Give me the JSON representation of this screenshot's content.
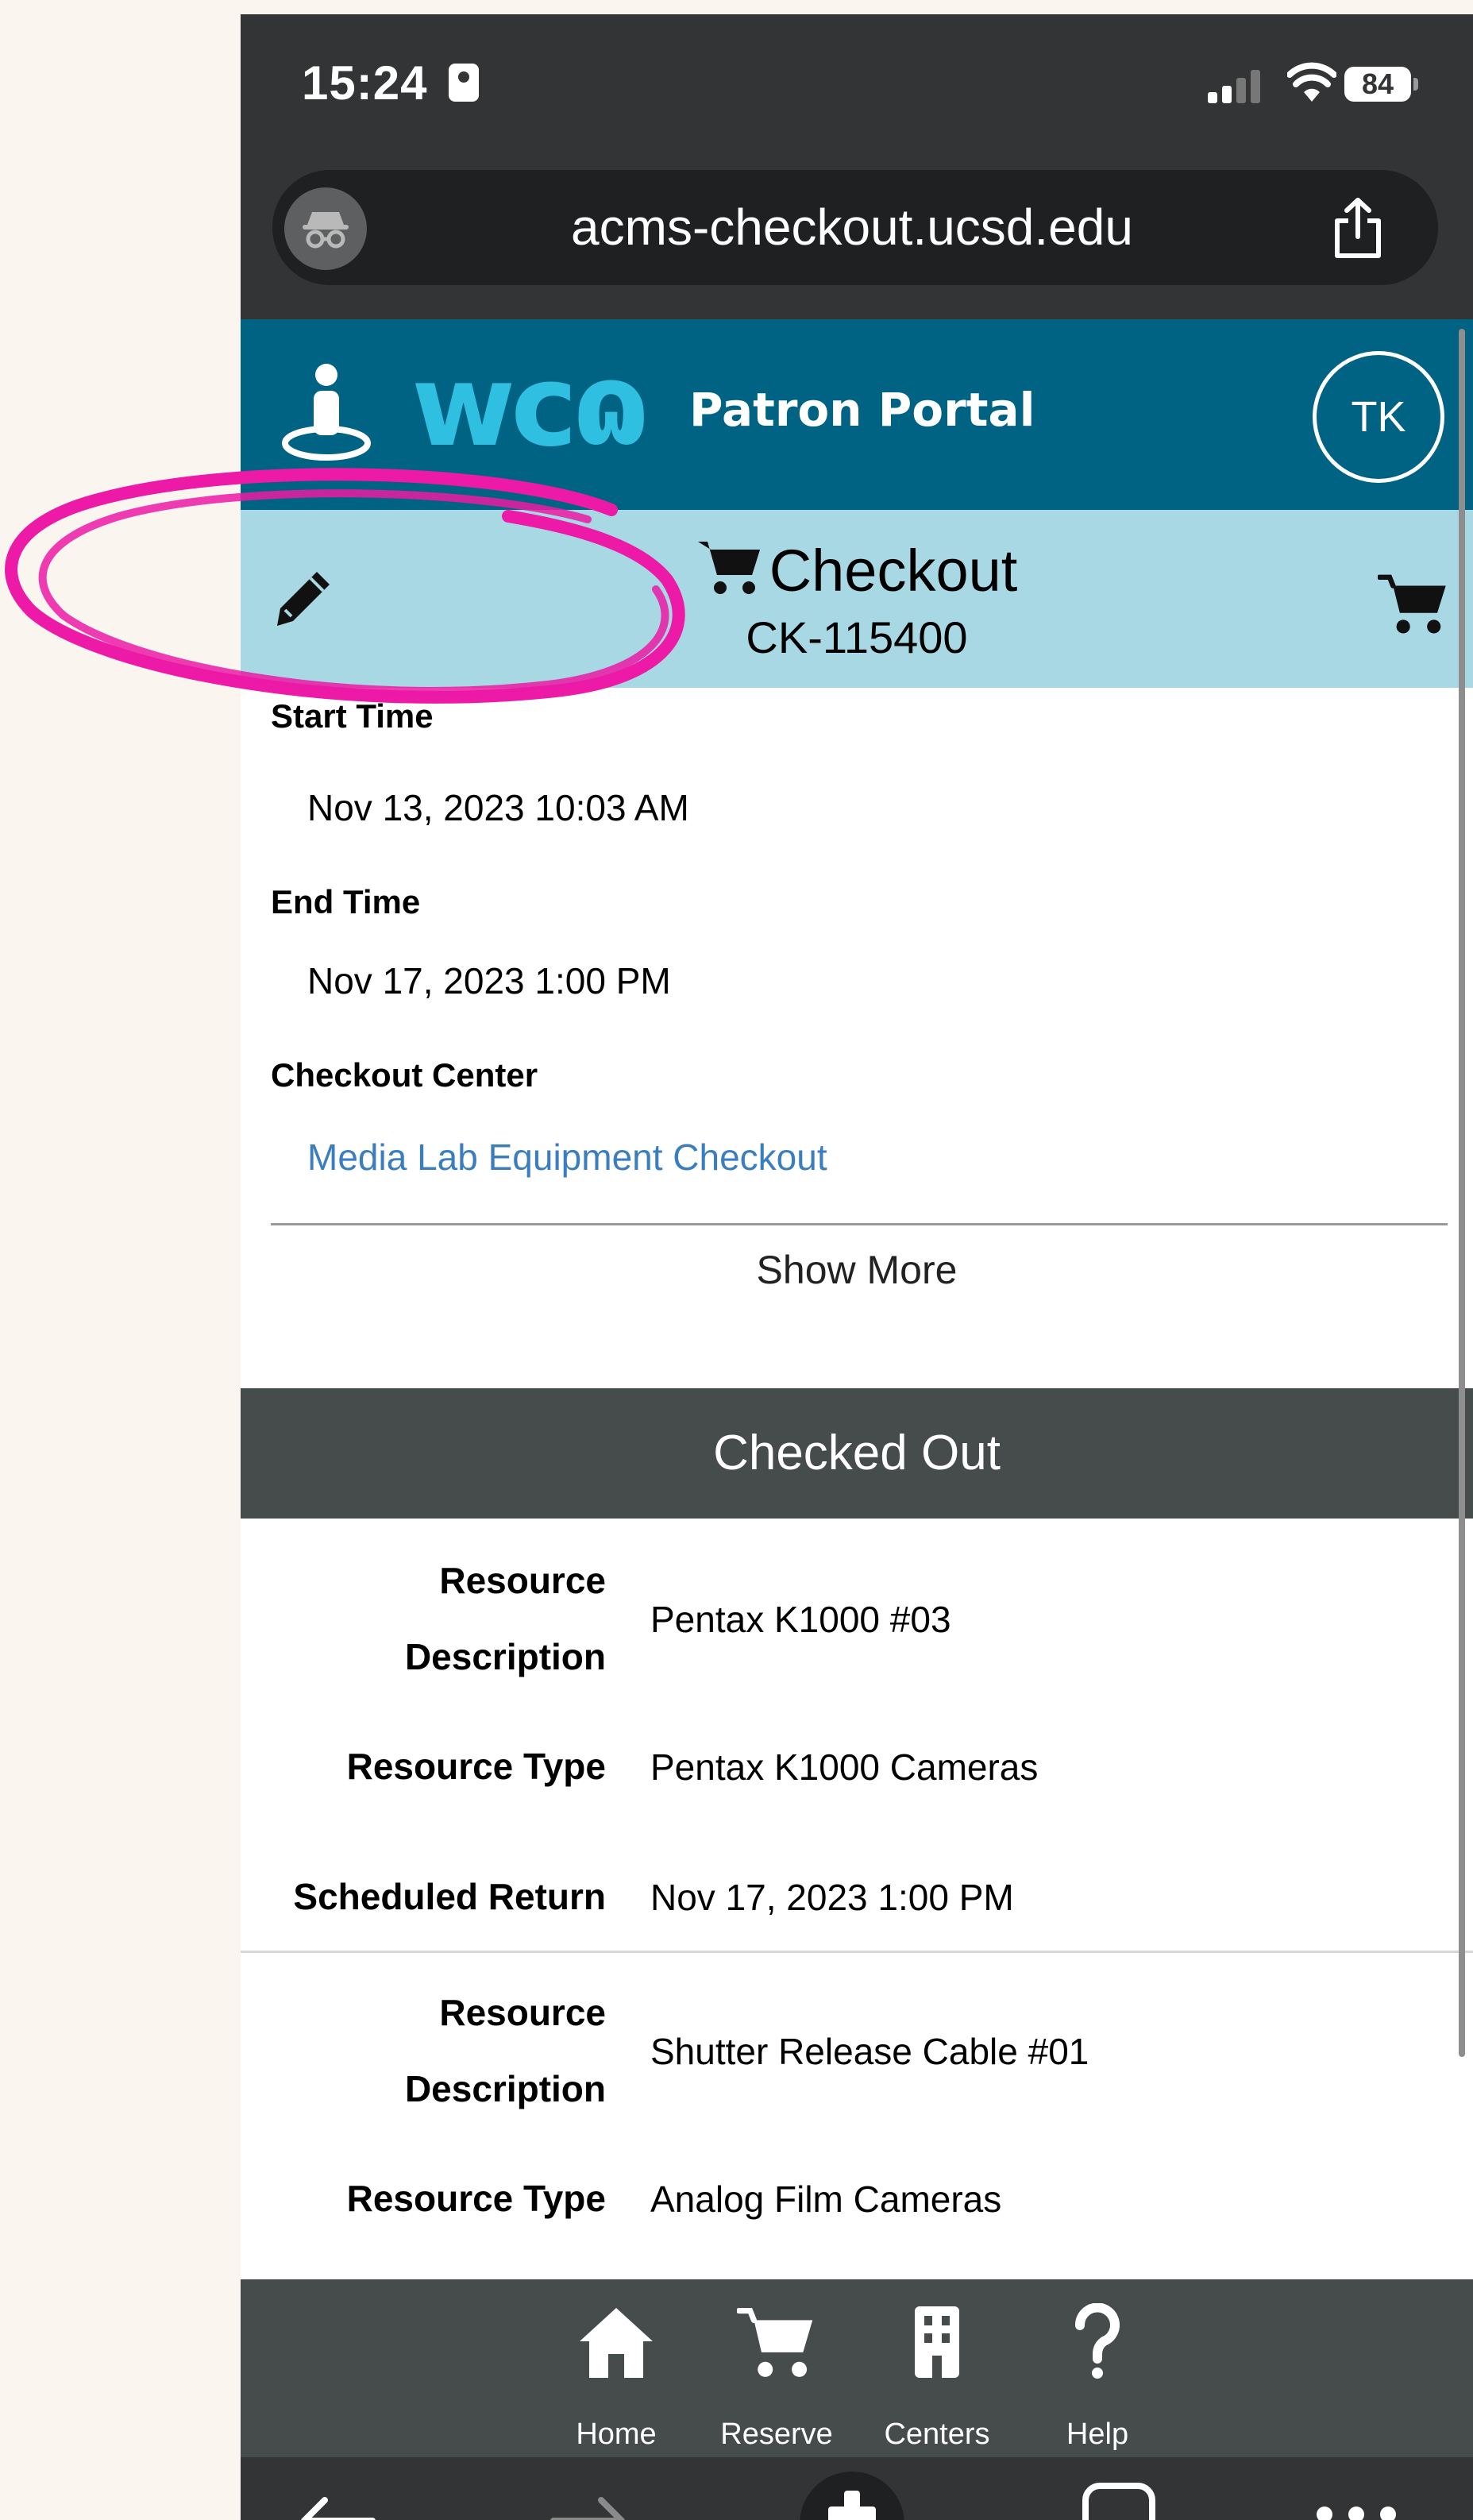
{
  "status_bar": {
    "time": "15:24",
    "battery": "84"
  },
  "browser": {
    "url": "acms-checkout.ucsd.edu"
  },
  "header": {
    "logo": "wcɷ",
    "title": "Patron Portal",
    "avatar_initials": "TK"
  },
  "checkout": {
    "title": "Checkout",
    "id": "CK-115400"
  },
  "details": {
    "start_time_label": "Start Time",
    "start_time_value": "Nov 13, 2023 10:03 AM",
    "end_time_label": "End Time",
    "end_time_value": "Nov 17, 2023 1:00 PM",
    "center_label": "Checkout Center",
    "center_value": "Media Lab Equipment Checkout",
    "show_more": "Show More"
  },
  "checked_out": {
    "heading": "Checked Out",
    "items": [
      {
        "desc_label_1": "Resource",
        "desc_label_2": "Description",
        "description": "Pentax K1000 #03",
        "type_label": "Resource Type",
        "type": "Pentax K1000 Cameras",
        "return_label": "Scheduled Return",
        "scheduled_return": "Nov 17, 2023 1:00 PM"
      },
      {
        "desc_label_1": "Resource",
        "desc_label_2": "Description",
        "description": "Shutter Release Cable #01",
        "type_label": "Resource Type",
        "type": "Analog Film Cameras"
      }
    ]
  },
  "nav": {
    "items": [
      {
        "label": "Home",
        "icon": "home-icon"
      },
      {
        "label": "Reserve",
        "icon": "cart-icon"
      },
      {
        "label": "Centers",
        "icon": "building-icon"
      },
      {
        "label": "Help",
        "icon": "question-icon"
      }
    ]
  },
  "colors": {
    "header_bg": "#006384",
    "checkout_bar_bg": "#a8d8e4",
    "section_header_bg": "#464b4c",
    "link": "#3a7ec0",
    "logo": "#2fbfe0",
    "annotation": "#ec1aa6"
  }
}
